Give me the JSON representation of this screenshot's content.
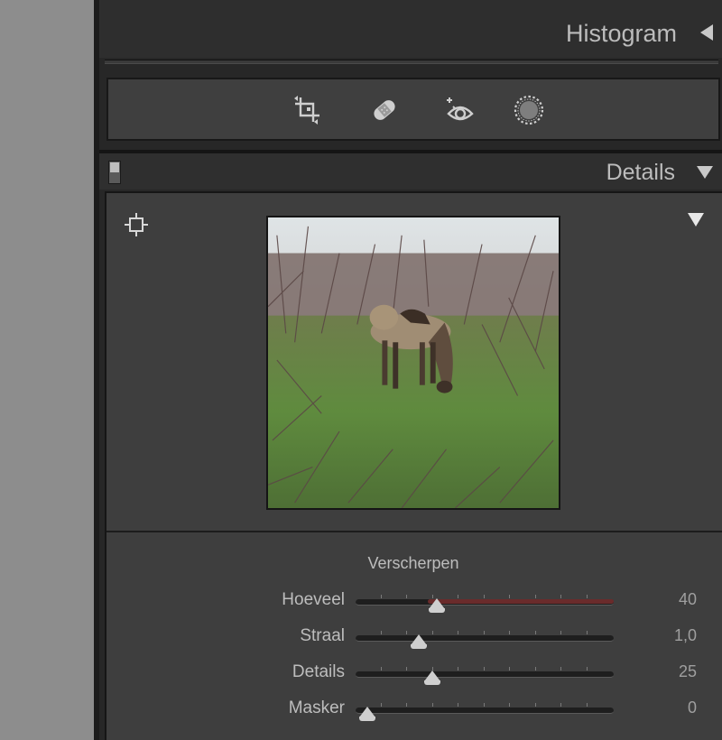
{
  "histogram": {
    "title": "Histogram",
    "collapse_icon": "triangle-left-icon"
  },
  "tools": [
    {
      "name": "crop-overlay-icon"
    },
    {
      "name": "spot-removal-icon"
    },
    {
      "name": "red-eye-icon"
    },
    {
      "name": "masking-icon"
    }
  ],
  "details": {
    "title": "Details",
    "collapse_icon": "triangle-down-icon",
    "preview_toggle_icon": "triangle-down-icon",
    "target_icon": "crosshair-target-icon",
    "section_title": "Verscherpen",
    "sliders": [
      {
        "label": "Hoeveel",
        "value": "40",
        "position": 0.27
      },
      {
        "label": "Straal",
        "value": "1,0",
        "position": 0.2
      },
      {
        "label": "Details",
        "value": "25",
        "position": 0.25
      },
      {
        "label": "Masker",
        "value": "0",
        "position": 0.0
      }
    ]
  },
  "colors": {
    "panel_bg": "#3e3e3e",
    "header_bg": "#2f2f2f",
    "text": "#bdbdbd",
    "sharpen_track_accent": "#6a2b2b"
  }
}
